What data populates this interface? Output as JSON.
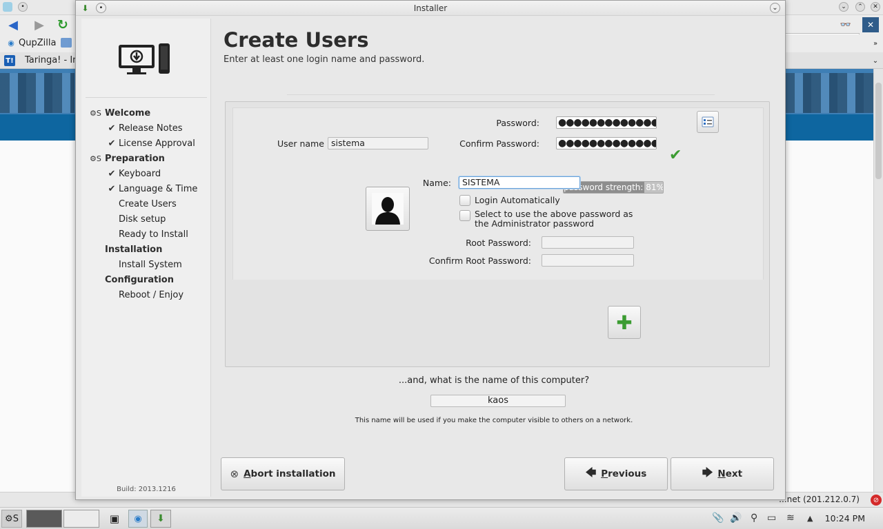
{
  "window": {
    "title": "Installer"
  },
  "browser": {
    "app_name": "QupZilla",
    "tab_title": "Taringa! - In",
    "status_text": "...net (201.212.0.7)"
  },
  "sidebar": {
    "sections": [
      {
        "label": "Welcome",
        "mark": "⚙S",
        "items": [
          {
            "label": "Release Notes",
            "done": true
          },
          {
            "label": "License Approval",
            "done": true
          }
        ]
      },
      {
        "label": "Preparation",
        "mark": "⚙S",
        "items": [
          {
            "label": "Keyboard",
            "done": true
          },
          {
            "label": "Language & Time",
            "done": true
          },
          {
            "label": "Create Users",
            "done": false
          },
          {
            "label": "Disk setup",
            "done": false
          },
          {
            "label": "Ready to Install",
            "done": false
          }
        ]
      },
      {
        "label": "Installation",
        "mark": "",
        "items": [
          {
            "label": "Install System",
            "done": false
          }
        ]
      },
      {
        "label": "Configuration",
        "mark": "",
        "items": [
          {
            "label": "Reboot / Enjoy",
            "done": false
          }
        ]
      }
    ],
    "build": "Build: 2013.1216"
  },
  "page": {
    "title": "Create Users",
    "subtitle": "Enter at least one login name and password."
  },
  "user_form": {
    "username_label": "User name",
    "username_value": "sistema",
    "password_label": "Password:",
    "password_value": "●●●●●●●●●●●●●●",
    "confirm_label": "Confirm Password:",
    "confirm_value": "●●●●●●●●●●●●●●",
    "strength_label": "password strength: 81%",
    "strength_fraction": 0.81,
    "name_label": "Name:",
    "name_value": "SISTEMA",
    "login_auto_label": "Login Automatically",
    "admin_pw_label": "Select to use the above password as the Administrator password",
    "root_pw_label": "Root Password:",
    "confirm_root_label": "Confirm Root Password:"
  },
  "computer": {
    "question": "...and, what is the name of this computer?",
    "value": "kaos",
    "hint": "This name will be used if you make the computer visible to others on a network."
  },
  "buttons": {
    "abort_pre": "A",
    "abort_rest": "bort installation",
    "previous_pre": "P",
    "previous_rest": "revious",
    "next_pre": "N",
    "next_rest": "ext"
  },
  "taskbar": {
    "clock": "10:24 PM"
  },
  "colors": {
    "accent_blue": "#0e66a0",
    "check_green": "#3c9c32"
  }
}
